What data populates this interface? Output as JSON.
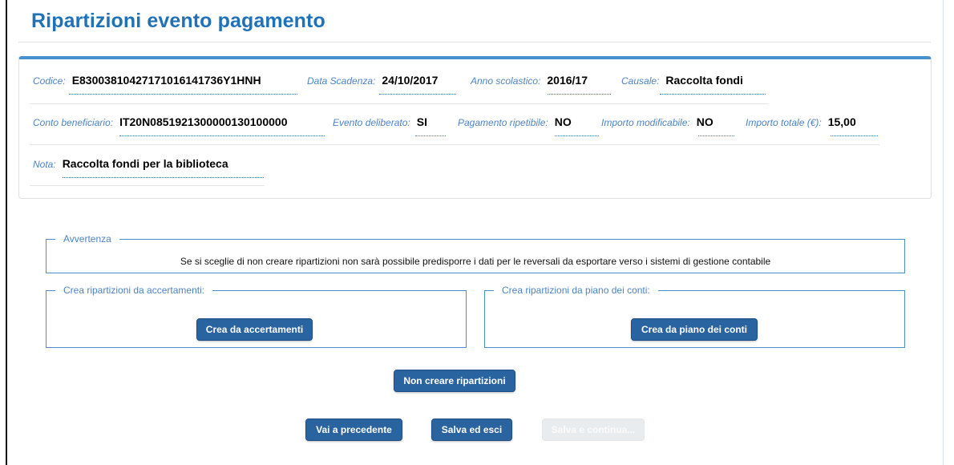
{
  "page": {
    "title": "Ripartizioni evento pagamento"
  },
  "details": {
    "codice": {
      "label": "Codice:",
      "value": "E830038104271710161417​36Y1HNH"
    },
    "data_scadenza": {
      "label": "Data Scadenza:",
      "value": "24/10/2017"
    },
    "anno_scolastico": {
      "label": "Anno scolastico:",
      "value": "2016/17"
    },
    "causale": {
      "label": "Causale:",
      "value": "Raccolta fondi"
    },
    "conto_beneficiario": {
      "label": "Conto beneficiario:",
      "value": "IT20N0851921300000130100000"
    },
    "evento_deliberato": {
      "label": "Evento deliberato:",
      "value": "SI"
    },
    "pagamento_ripetibile": {
      "label": "Pagamento ripetibile:",
      "value": "NO"
    },
    "importo_modificabile": {
      "label": "Importo modificabile:",
      "value": "NO"
    },
    "importo_totale": {
      "label": "Importo totale (€):",
      "value": "15,00"
    },
    "nota": {
      "label": "Nota:",
      "value": "Raccolta fondi per la biblioteca"
    }
  },
  "avvertenza": {
    "legend": "Avvertenza",
    "text": "Se si sceglie di non creare ripartizioni non sarà possibile predisporre i dati per le reversali da esportare verso i sistemi di gestione contabile"
  },
  "accertamenti": {
    "legend": "Crea ripartizioni da accertamenti:",
    "button": "Crea da accertamenti"
  },
  "piano_conti": {
    "legend": "Crea ripartizioni da piano dei conti:",
    "button": "Crea da piano dei conti"
  },
  "actions": {
    "non_creare": "Non creare ripartizioni",
    "precedente": "Vai a precedente",
    "salva_esci": "Salva ed esci",
    "salva_continua": "Salva e continua..."
  },
  "colors": {
    "title": "#1f72b8",
    "label": "#4d83c4",
    "card_accent": "#4a90cf",
    "button": "#2a64a0",
    "button_disabled": "#e9ecef"
  }
}
